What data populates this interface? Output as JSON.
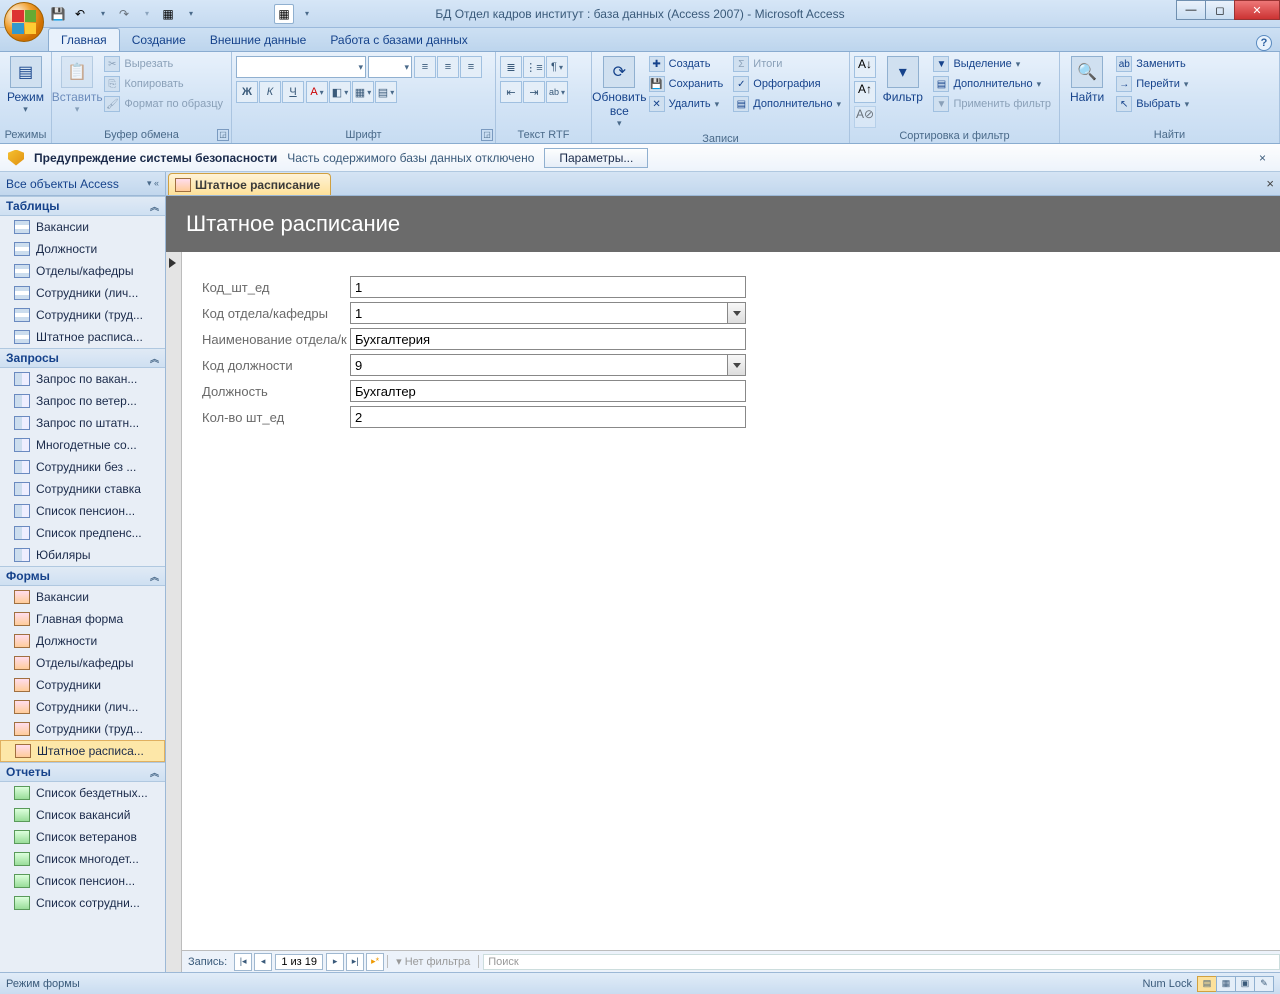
{
  "window": {
    "title": "БД Отдел кадров институт : база данных (Access 2007) - Microsoft Access"
  },
  "ribbon_tabs": [
    "Главная",
    "Создание",
    "Внешние данные",
    "Работа с базами данных"
  ],
  "ribbon_groups": {
    "modes": "Режимы",
    "modes_btn": "Режим",
    "clipboard": "Буфер обмена",
    "paste": "Вставить",
    "cut": "Вырезать",
    "copy": "Копировать",
    "fmt": "Формат по образцу",
    "font": "Шрифт",
    "richtext": "Текст RTF",
    "records": "Записи",
    "refresh": "Обновить все",
    "new": "Создать",
    "save": "Сохранить",
    "delete": "Удалить",
    "totals": "Итоги",
    "spell": "Орфография",
    "more": "Дополнительно",
    "sortfilter": "Сортировка и фильтр",
    "filter": "Фильтр",
    "sel": "Выделение",
    "adv": "Дополнительно",
    "apply": "Применить фильтр",
    "find_grp": "Найти",
    "find": "Найти",
    "replace": "Заменить",
    "goto": "Перейти",
    "select": "Выбрать"
  },
  "security": {
    "heading": "Предупреждение системы безопасности",
    "msg": "Часть содержимого базы данных отключено",
    "btn": "Параметры..."
  },
  "nav": {
    "header": "Все объекты Access",
    "groups": {
      "tables": "Таблицы",
      "queries": "Запросы",
      "forms": "Формы",
      "reports": "Отчеты"
    },
    "tables": [
      "Вакансии",
      "Должности",
      "Отделы/кафедры",
      "Сотрудники (лич...",
      "Сотрудники (труд...",
      "Штатное расписа..."
    ],
    "queries": [
      "Запрос по вакан...",
      "Запрос по ветер...",
      "Запрос по штатн...",
      "Многодетные со...",
      "Сотрудники без ...",
      "Сотрудники ставка",
      "Список пенсион...",
      "Список предпенс...",
      "Юбиляры"
    ],
    "forms": [
      "Вакансии",
      "Главная форма",
      "Должности",
      "Отделы/кафедры",
      "Сотрудники",
      "Сотрудники (лич...",
      "Сотрудники (труд...",
      "Штатное расписа..."
    ],
    "reports": [
      "Список бездетных...",
      "Список вакансий",
      "Список ветеранов",
      "Список многодет...",
      "Список пенсион...",
      "Список сотрудни..."
    ]
  },
  "doc": {
    "tab": "Штатное расписание",
    "title": "Штатное расписание"
  },
  "form": {
    "fields": {
      "kod_sht": "Код_шт_ед",
      "kod_otd": "Код отдела/кафедры",
      "naim": "Наименование отдела/к",
      "kod_dol": "Код должности",
      "dol": "Должность",
      "kolvo": "Кол-во шт_ед"
    },
    "values": {
      "kod_sht": "1",
      "kod_otd": "1",
      "naim": "Бухгалтерия",
      "kod_dol": "9",
      "dol": "Бухгалтер",
      "kolvo": "2"
    }
  },
  "recnav": {
    "label": "Запись:",
    "pos": "1 из 19",
    "nofilter": "Нет фильтра",
    "search": "Поиск"
  },
  "status": {
    "mode": "Режим формы",
    "numlock": "Num Lock"
  }
}
